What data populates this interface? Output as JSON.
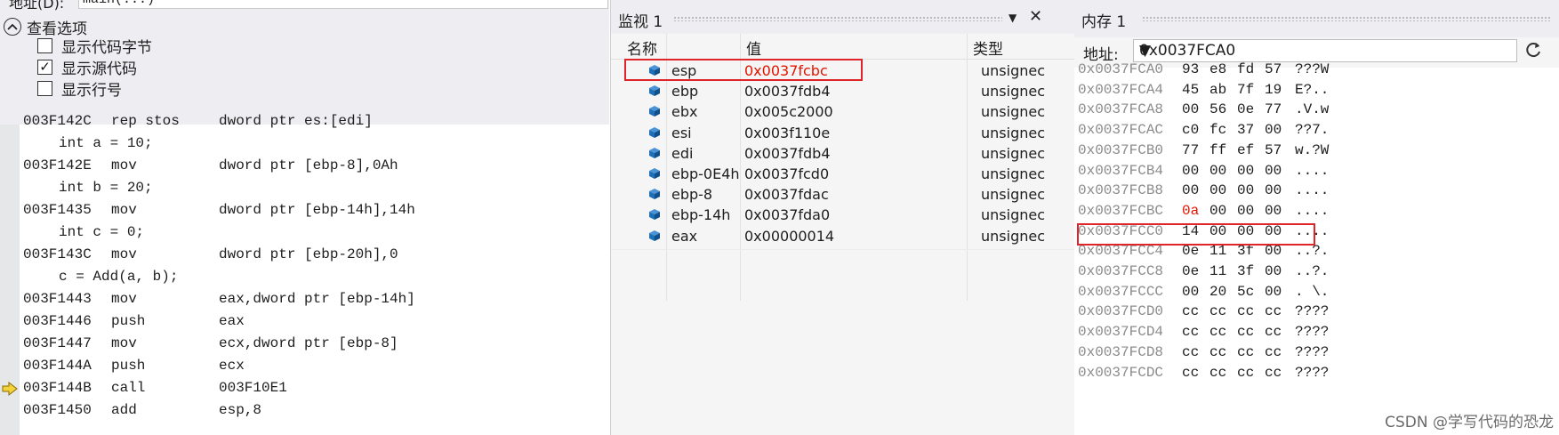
{
  "disasm": {
    "address_label": "地址(D):",
    "address_value": "main(...)",
    "view_options_label": "查看选项",
    "options": [
      {
        "label": "显示代码字节",
        "checked": false
      },
      {
        "label": "显示源代码",
        "checked": true
      },
      {
        "label": "显示行号",
        "checked": false
      }
    ],
    "lines": [
      {
        "type": "asm",
        "addr": "003F142C",
        "op": "rep stos",
        "arg": "dword ptr es:[edi]"
      },
      {
        "type": "src",
        "text": "int a = 10;"
      },
      {
        "type": "asm",
        "addr": "003F142E",
        "op": "mov",
        "arg": "dword ptr [ebp-8],0Ah"
      },
      {
        "type": "src",
        "text": "int b = 20;"
      },
      {
        "type": "asm",
        "addr": "003F1435",
        "op": "mov",
        "arg": "dword ptr [ebp-14h],14h"
      },
      {
        "type": "src",
        "text": "int c = 0;"
      },
      {
        "type": "asm",
        "addr": "003F143C",
        "op": "mov",
        "arg": "dword ptr [ebp-20h],0"
      },
      {
        "type": "src",
        "text": "c = Add(a, b);"
      },
      {
        "type": "asm",
        "addr": "003F1443",
        "op": "mov",
        "arg": "eax,dword ptr [ebp-14h]"
      },
      {
        "type": "asm",
        "addr": "003F1446",
        "op": "push",
        "arg": "eax"
      },
      {
        "type": "asm",
        "addr": "003F1447",
        "op": "mov",
        "arg": "ecx,dword ptr [ebp-8]"
      },
      {
        "type": "asm",
        "addr": "003F144A",
        "op": "push",
        "arg": "ecx"
      },
      {
        "type": "asm",
        "addr": "003F144B",
        "op": "call",
        "arg": "003F10E1",
        "current": true
      },
      {
        "type": "asm",
        "addr": "003F1450",
        "op": "add",
        "arg": "esp,8"
      }
    ]
  },
  "watch": {
    "title": "监视 1",
    "columns": {
      "name": "名称",
      "value": "值",
      "type": "类型"
    },
    "rows": [
      {
        "name": "esp",
        "value": "0x0037fcbc",
        "type": "unsignec",
        "changed": true
      },
      {
        "name": "ebp",
        "value": "0x0037fdb4",
        "type": "unsignec"
      },
      {
        "name": "ebx",
        "value": "0x005c2000",
        "type": "unsignec"
      },
      {
        "name": "esi",
        "value": "0x003f110e",
        "type": "unsignec"
      },
      {
        "name": "edi",
        "value": "0x0037fdb4",
        "type": "unsignec"
      },
      {
        "name": "ebp-0E4h",
        "value": "0x0037fcd0",
        "type": "unsignec"
      },
      {
        "name": "ebp-8",
        "value": "0x0037fdac",
        "type": "unsignec"
      },
      {
        "name": "ebp-14h",
        "value": "0x0037fda0",
        "type": "unsignec"
      },
      {
        "name": "eax",
        "value": "0x00000014",
        "type": "unsignec"
      }
    ]
  },
  "memory": {
    "title": "内存 1",
    "address_label": "地址:",
    "address_value": "0x0037FCA0",
    "rows": [
      {
        "addr": "0x0037FCA0",
        "bytes": [
          "93",
          "e8",
          "fd",
          "57"
        ],
        "ascii": "???W"
      },
      {
        "addr": "0x0037FCA4",
        "bytes": [
          "45",
          "ab",
          "7f",
          "19"
        ],
        "ascii": "E?.."
      },
      {
        "addr": "0x0037FCA8",
        "bytes": [
          "00",
          "56",
          "0e",
          "77"
        ],
        "ascii": ".V.w"
      },
      {
        "addr": "0x0037FCAC",
        "bytes": [
          "c0",
          "fc",
          "37",
          "00"
        ],
        "ascii": "??7."
      },
      {
        "addr": "0x0037FCB0",
        "bytes": [
          "77",
          "ff",
          "ef",
          "57"
        ],
        "ascii": "w.?W"
      },
      {
        "addr": "0x0037FCB4",
        "bytes": [
          "00",
          "00",
          "00",
          "00"
        ],
        "ascii": "...."
      },
      {
        "addr": "0x0037FCB8",
        "bytes": [
          "00",
          "00",
          "00",
          "00"
        ],
        "ascii": "...."
      },
      {
        "addr": "0x0037FCBC",
        "bytes": [
          "0a",
          "00",
          "00",
          "00"
        ],
        "ascii": "....",
        "highlight": true,
        "first_changed": true
      },
      {
        "addr": "0x0037FCC0",
        "bytes": [
          "14",
          "00",
          "00",
          "00"
        ],
        "ascii": "...."
      },
      {
        "addr": "0x0037FCC4",
        "bytes": [
          "0e",
          "11",
          "3f",
          "00"
        ],
        "ascii": "..?."
      },
      {
        "addr": "0x0037FCC8",
        "bytes": [
          "0e",
          "11",
          "3f",
          "00"
        ],
        "ascii": "..?."
      },
      {
        "addr": "0x0037FCCC",
        "bytes": [
          "00",
          "20",
          "5c",
          "00"
        ],
        "ascii": ". \\."
      },
      {
        "addr": "0x0037FCD0",
        "bytes": [
          "cc",
          "cc",
          "cc",
          "cc"
        ],
        "ascii": "????"
      },
      {
        "addr": "0x0037FCD4",
        "bytes": [
          "cc",
          "cc",
          "cc",
          "cc"
        ],
        "ascii": "????"
      },
      {
        "addr": "0x0037FCD8",
        "bytes": [
          "cc",
          "cc",
          "cc",
          "cc"
        ],
        "ascii": "????"
      },
      {
        "addr": "0x0037FCDC",
        "bytes": [
          "cc",
          "cc",
          "cc",
          "cc"
        ],
        "ascii": "????"
      }
    ]
  },
  "watermark": "CSDN @学写代码的恐龙",
  "colors": {
    "highlight_box": "#e0252a",
    "changed_value": "#e51400",
    "address_gray": "#8b8b8b",
    "cube_icon": "#1e6fb5"
  }
}
